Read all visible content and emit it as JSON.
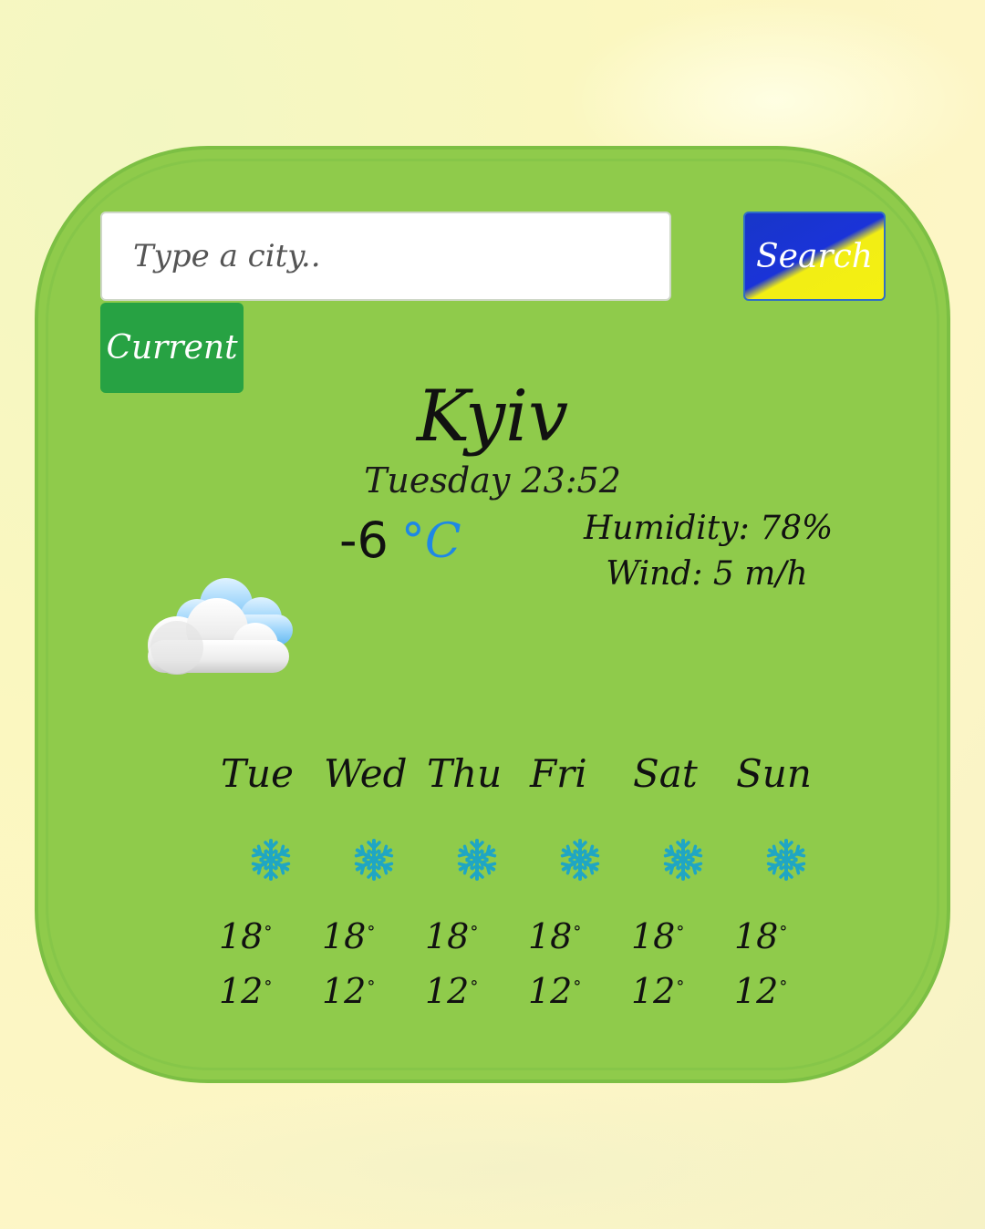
{
  "search": {
    "placeholder": "Type a city..",
    "value": "",
    "search_label": "Search",
    "current_label": "Current"
  },
  "weather": {
    "city": "Kyiv",
    "datetime": "Tuesday 23:52",
    "temperature": "-6",
    "unit": "°C",
    "humidity": "Humidity: 78%",
    "wind": "Wind: 5 m/h",
    "icon": "cloud-icon"
  },
  "forecast": [
    {
      "day": "Tue",
      "icon": "snowflake-icon",
      "max": "18",
      "min": "12"
    },
    {
      "day": "Wed",
      "icon": "snowflake-icon",
      "max": "18",
      "min": "12"
    },
    {
      "day": "Thu",
      "icon": "snowflake-icon",
      "max": "18",
      "min": "12"
    },
    {
      "day": "Fri",
      "icon": "snowflake-icon",
      "max": "18",
      "min": "12"
    },
    {
      "day": "Sat",
      "icon": "snowflake-icon",
      "max": "18",
      "min": "12"
    },
    {
      "day": "Sun",
      "icon": "snowflake-icon",
      "max": "18",
      "min": "12"
    }
  ],
  "degree_symbol": "°",
  "colors": {
    "card": "#8fcb4b",
    "current_button": "#27a243",
    "search_blue": "#1836c8",
    "search_yellow": "#f2ee14",
    "unit_blue": "#1e88e5",
    "snowflake": "#1fa6c4"
  }
}
